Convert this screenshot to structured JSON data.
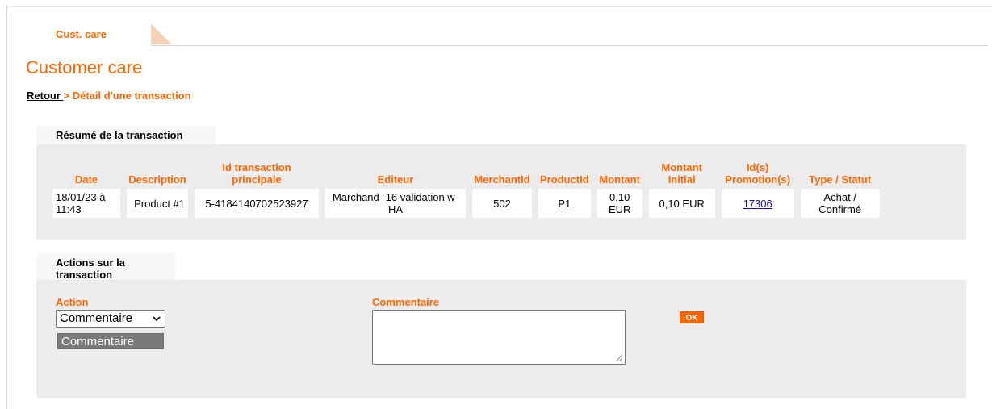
{
  "tabs": {
    "active_label": "Cust. care"
  },
  "page": {
    "title": "Customer care"
  },
  "breadcrumb": {
    "back_label": "Retour ",
    "separator": "> ",
    "current": "Détail d'une transaction"
  },
  "summary": {
    "heading": "Résumé de la transaction",
    "columns": [
      "Date",
      "Description",
      "Id transaction principale",
      "Editeur",
      "MerchantId",
      "ProductId",
      "Montant",
      "Montant Initial",
      "Id(s) Promotion(s)",
      "Type / Statut"
    ],
    "row": {
      "date": "18/01/23 à 11:43",
      "description": "Product #1",
      "transaction_id": "5-4184140702523927",
      "editeur": "Marchand -16 validation w-HA",
      "merchant_id": "502",
      "product_id": "P1",
      "montant": "0,10 EUR",
      "montant_initial": "0,10 EUR",
      "promotion_ids": "17306",
      "type_statut": "Achat / Confirmé"
    }
  },
  "actions": {
    "heading": "Actions sur la transaction",
    "action_label": "Action",
    "action_selected": "Commentaire",
    "action_options": [
      "Commentaire"
    ],
    "comment_label": "Commentaire",
    "comment_value": "",
    "ok_label": "OK"
  },
  "colors": {
    "accent": "#ff6600",
    "panel": "#ececec",
    "link": "#1a0dab"
  },
  "icons": {
    "select_arrow": "chevron-down-icon",
    "resize": "resize-grip-icon"
  }
}
